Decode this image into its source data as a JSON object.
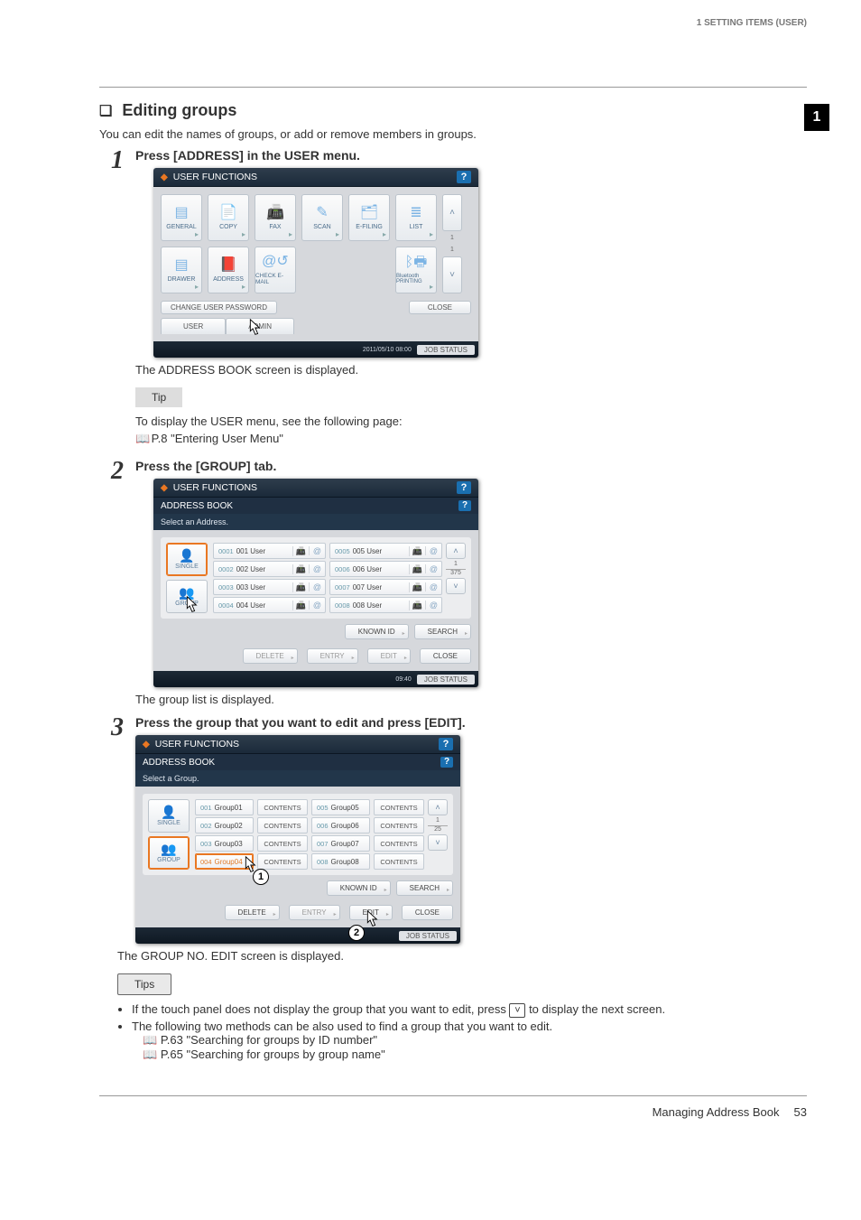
{
  "running_head": "1 SETTING ITEMS (USER)",
  "side_tab": "1",
  "section": {
    "title": "Editing groups",
    "intro": "You can edit the names of groups, or add or remove members in groups."
  },
  "steps": [
    {
      "num": "1",
      "title": "Press [ADDRESS] in the USER menu.",
      "after_note": "The ADDRESS BOOK screen is displayed."
    },
    {
      "num": "2",
      "title": "Press the [GROUP] tab.",
      "after_note": "The group list is displayed."
    },
    {
      "num": "3",
      "title": "Press the group that you want to edit and press [EDIT].",
      "after_note": "The GROUP NO. EDIT screen is displayed."
    }
  ],
  "tip1": {
    "label": "Tip",
    "text": "To display the USER menu, see the following page:",
    "ref": "P.8 \"Entering User Menu\""
  },
  "tip2": {
    "label": "Tips",
    "bullet1": "If the touch panel does not display the group that you want to edit, press ",
    "bullet1_tail": " to display the next screen.",
    "bullet2": "The following two methods can be also used to find a group that you want to edit.",
    "ref1": "P.63 \"Searching for groups by ID number\"",
    "ref2": "P.65 \"Searching for groups by group name\""
  },
  "footer": {
    "title": "Managing Address Book",
    "page": "53"
  },
  "shot1": {
    "title": "USER FUNCTIONS",
    "tiles_row1": [
      "GENERAL",
      "COPY",
      "FAX",
      "SCAN",
      "E-FILING",
      "LIST"
    ],
    "tiles_row2": [
      "DRAWER",
      "ADDRESS",
      "CHECK E-MAIL",
      "",
      "",
      "Bluetooth PRINTING"
    ],
    "page_ind": [
      "1",
      "1"
    ],
    "change_pw": "CHANGE USER PASSWORD",
    "close": "CLOSE",
    "tabs": [
      "USER",
      "ADMIN"
    ],
    "time": "2011/05/10 08:00",
    "job": "JOB STATUS"
  },
  "shot2": {
    "title": "USER FUNCTIONS",
    "sub": "ADDRESS BOOK",
    "select": "Select an Address.",
    "side": {
      "single": "SINGLE",
      "group": "GROUP"
    },
    "col1": [
      {
        "n": "0001",
        "name": "001 User"
      },
      {
        "n": "0002",
        "name": "002 User"
      },
      {
        "n": "0003",
        "name": "003 User"
      },
      {
        "n": "0004",
        "name": "004 User"
      }
    ],
    "col2": [
      {
        "n": "0005",
        "name": "005 User"
      },
      {
        "n": "0006",
        "name": "006 User"
      },
      {
        "n": "0007",
        "name": "007 User"
      },
      {
        "n": "0008",
        "name": "008 User"
      }
    ],
    "pages": [
      "1",
      "375"
    ],
    "actions": {
      "knownid": "KNOWN ID",
      "search": "SEARCH",
      "delete": "DELETE",
      "entry": "ENTRY",
      "edit": "EDIT",
      "close": "CLOSE"
    },
    "time": "09:40",
    "job": "JOB STATUS"
  },
  "shot3": {
    "title": "USER FUNCTIONS",
    "sub": "ADDRESS BOOK",
    "select": "Select a Group.",
    "side": {
      "single": "SINGLE",
      "group": "GROUP"
    },
    "contents": "CONTENTS",
    "col1": [
      {
        "n": "001",
        "name": "Group01"
      },
      {
        "n": "002",
        "name": "Group02"
      },
      {
        "n": "003",
        "name": "Group03"
      },
      {
        "n": "004",
        "name": "Group04"
      }
    ],
    "col2": [
      {
        "n": "005",
        "name": "Group05"
      },
      {
        "n": "006",
        "name": "Group06"
      },
      {
        "n": "007",
        "name": "Group07"
      },
      {
        "n": "008",
        "name": "Group08"
      }
    ],
    "pages": [
      "1",
      "25"
    ],
    "actions": {
      "knownid": "KNOWN ID",
      "search": "SEARCH",
      "delete": "DELETE",
      "entry": "ENTRY",
      "edit": "EDIT",
      "close": "CLOSE"
    },
    "time": "",
    "job": "JOB STATUS",
    "callouts": [
      "1",
      "2"
    ]
  }
}
